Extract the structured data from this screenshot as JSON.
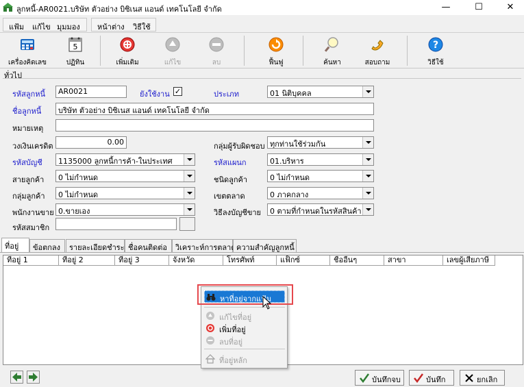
{
  "window": {
    "title": "ลูกหนี้-AR0021.บริษัท ตัวอย่าง บิซิเนส แอนด์ เทคโนโลยี จำกัด",
    "minimize": "—",
    "maximize": "☐",
    "close": "✕"
  },
  "menu": {
    "file": "แฟ้ม",
    "edit": "แก้ไข",
    "view": "มุมมอง",
    "window": "หน้าต่าง",
    "help": "วิธีใช้"
  },
  "toolbar": {
    "calculator": "เครื่องคิดเลข",
    "calendar": "ปฏิทิน",
    "calendar_day": "5",
    "add": "เพิ่มเติม",
    "edit": "แก้ไข",
    "delete": "ลบ",
    "restore": "ฟื้นฟู",
    "search": "ค้นหา",
    "inquiry": "สอบถาม",
    "help": "วิธีใช้"
  },
  "section": {
    "general": "ทั่วไป"
  },
  "form": {
    "code_label": "รหัสลูกหนี้",
    "code_value": "AR0021",
    "active_label": "ยังใช้งาน",
    "active_checked": "✓",
    "type_label": "ประเภท",
    "type_value": "01 นิติบุคคล",
    "name_label": "ชื่อลูกหนี้",
    "name_value": "บริษัท ตัวอย่าง บิซิเนส แอนด์ เทคโนโลยี จำกัด",
    "note_label": "หมายเหตุ",
    "note_value": "",
    "credit_label": "วงเงินเครดิต",
    "credit_value": "0.00",
    "responsible_label": "กลุ่มผู้รับผิดชอบ",
    "responsible_value": "ทุกท่านใช้ร่วมกัน",
    "account_label": "รหัสบัญชี",
    "account_value": "1135000 ลูกหนี้การค้า-ในประเทศ",
    "dept_label": "รหัสแผนก",
    "dept_value": "01.บริหาร",
    "line_label": "สายลูกค้า",
    "line_value": "0 ไม่กำหนด",
    "ctype_label": "ชนิดลูกค้า",
    "ctype_value": "0 ไม่กำหนด",
    "group_label": "กลุ่มลูกค้า",
    "group_value": "0 ไม่กำหนด",
    "zone_label": "เขตตลาด",
    "zone_value": "0 ภาคกลาง",
    "sales_label": "พนักงานขาย",
    "sales_value": "0.ขายเอง",
    "acctmethod_label": "วิธีลงบัญชีขาย",
    "acctmethod_value": "0 ตามที่กำหนดในรหัสสินค้า",
    "member_label": "รหัสสมาชิก",
    "member_value": ""
  },
  "tabs": [
    "ที่อยู่",
    "ข้อตกลง",
    "รายละเอียดชำระ",
    "ชื่อคนติดต่อ",
    "วิเคราะห์การตลาด",
    "ความสำคัญลูกหนี้"
  ],
  "grid": {
    "headers": [
      "ที่อยู่ 1",
      "ที่อยู่ 2",
      "ที่อยู่ 3",
      "จังหวัด",
      "โทรศัพท์",
      "แฟ็กซ์",
      "ชื่ออื่นๆ",
      "สาขา",
      "เลขผู้เสียภาษี"
    ]
  },
  "context_menu": {
    "find": "หาที่อยู่จากแฟ้ม",
    "edit": "แก้ไขที่อยู่",
    "add": "เพิ่มที่อยู่",
    "delete": "ลบที่อยู่",
    "main": "ที่อยู่หลัก"
  },
  "bottom": {
    "save_close": "บันทึกจบ",
    "save": "บันทึก",
    "cancel": "ยกเลิก"
  },
  "colors": {
    "accent_blue": "#1978d4",
    "label_blue": "#1a1acc",
    "highlight_red": "#e5484d"
  }
}
